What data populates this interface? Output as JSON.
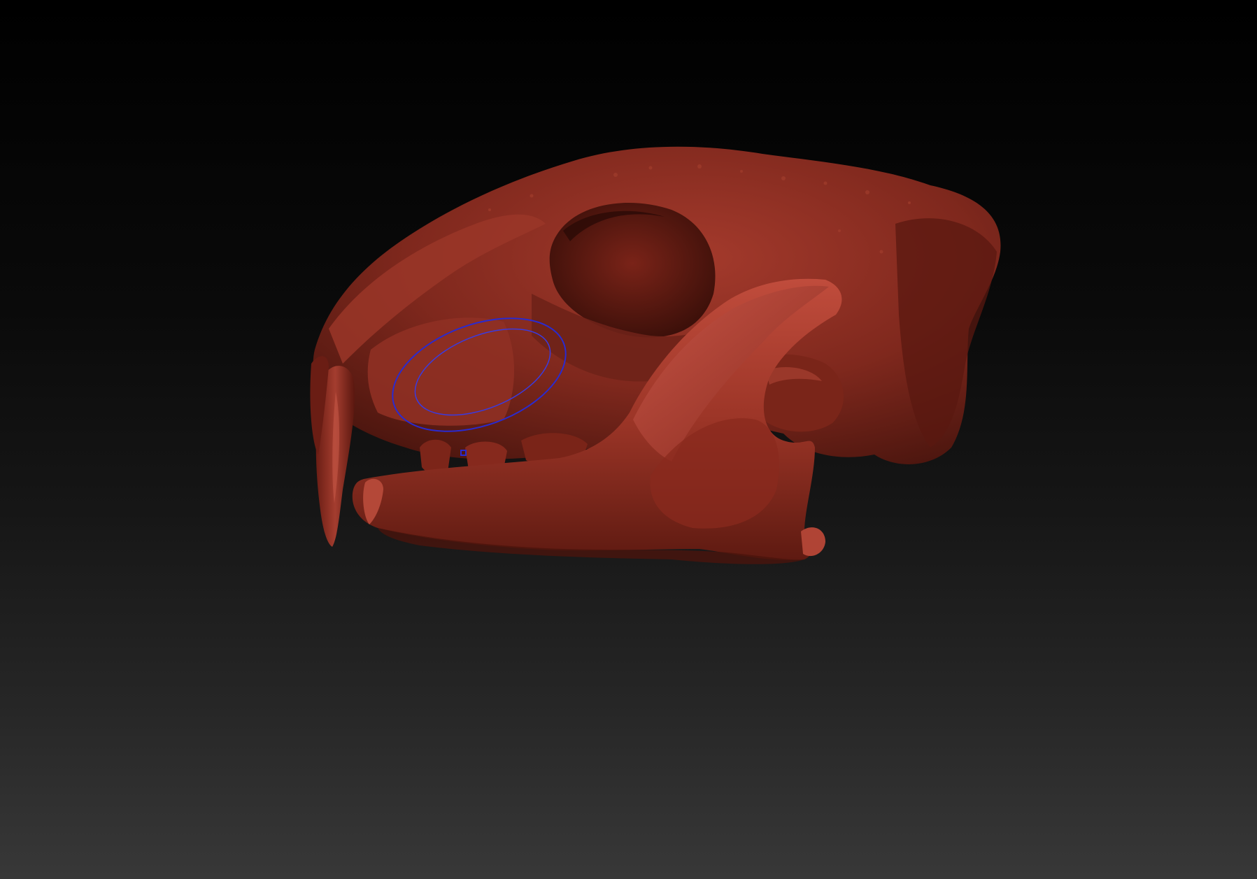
{
  "viewport": {
    "background_top": "#000000",
    "background_bottom": "#383838"
  },
  "model": {
    "subject": "sculpted-skull-mesh",
    "material_color": "#8a2e22",
    "highlight_color": "#b2493a",
    "shadow_color": "#3e120c"
  },
  "brush": {
    "icon": "brush-cursor-icon",
    "outer_ring_color": "#2a2ad0",
    "inner_ring_color": "#3a3ae0"
  }
}
